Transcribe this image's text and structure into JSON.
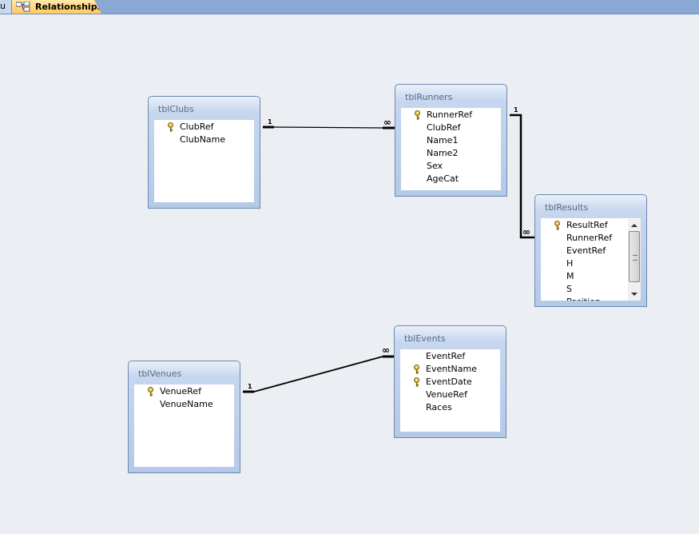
{
  "tabs": {
    "previous_label": "u",
    "active_label": "Relationships",
    "active_icon": "relationships-icon"
  },
  "tables": [
    {
      "id": "clubs",
      "name": "tblClubs",
      "fields": [
        {
          "name": "ClubRef",
          "key": true
        },
        {
          "name": "ClubName",
          "key": false
        }
      ]
    },
    {
      "id": "runners",
      "name": "tblRunners",
      "fields": [
        {
          "name": "RunnerRef",
          "key": true
        },
        {
          "name": "ClubRef",
          "key": false
        },
        {
          "name": "Name1",
          "key": false
        },
        {
          "name": "Name2",
          "key": false
        },
        {
          "name": "Sex",
          "key": false
        },
        {
          "name": "AgeCat",
          "key": false
        }
      ]
    },
    {
      "id": "results",
      "name": "tblResults",
      "scrollbar": true,
      "fields": [
        {
          "name": "ResultRef",
          "key": true
        },
        {
          "name": "RunnerRef",
          "key": false
        },
        {
          "name": "EventRef",
          "key": false
        },
        {
          "name": "H",
          "key": false
        },
        {
          "name": "M",
          "key": false
        },
        {
          "name": "S",
          "key": false
        },
        {
          "name": "Position",
          "key": false
        }
      ]
    },
    {
      "id": "events",
      "name": "tblEvents",
      "fields": [
        {
          "name": "EventRef",
          "key": false
        },
        {
          "name": "EventName",
          "key": true
        },
        {
          "name": "EventDate",
          "key": true
        },
        {
          "name": "VenueRef",
          "key": false
        },
        {
          "name": "Races",
          "key": false
        }
      ]
    },
    {
      "id": "venues",
      "name": "tblVenues",
      "fields": [
        {
          "name": "VenueRef",
          "key": true
        },
        {
          "name": "VenueName",
          "key": false
        }
      ]
    }
  ],
  "relationships": [
    {
      "from": "tblClubs.ClubRef",
      "to": "tblRunners.ClubRef",
      "one": "1",
      "many": "∞"
    },
    {
      "from": "tblRunners.RunnerRef",
      "to": "tblResults.RunnerRef",
      "one": "1",
      "many": "∞"
    },
    {
      "from": "tblVenues.VenueRef",
      "to": "tblEvents.VenueRef",
      "one": "1",
      "many": "∞"
    }
  ]
}
